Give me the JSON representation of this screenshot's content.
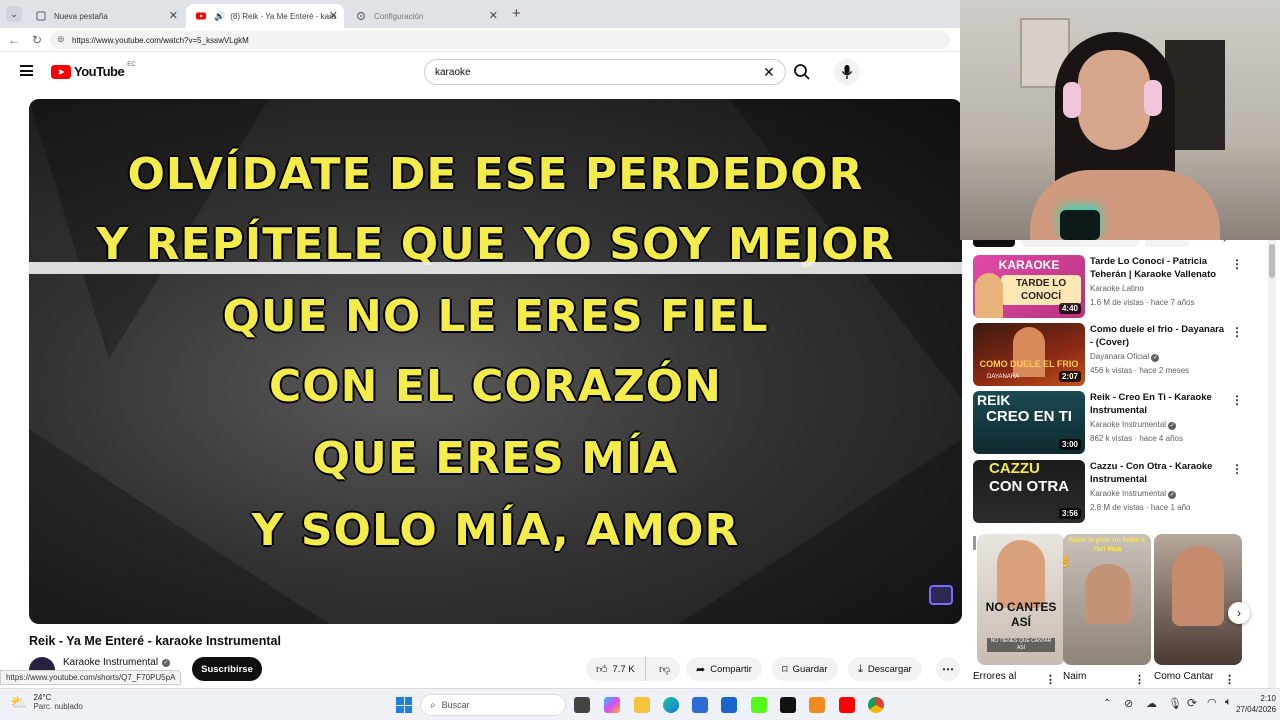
{
  "browser": {
    "tabs": [
      {
        "label": "Nueva pestaña"
      },
      {
        "label": "(8) Reik - Ya Me Enteré - kara"
      },
      {
        "label": "Configuración"
      }
    ],
    "url": "https://www.youtube.com/watch?v=5_ksswVLgkM",
    "status_url": "https://www.youtube.com/shorts/Q7_F70PU5pA"
  },
  "youtube": {
    "logo_text": "YouTube",
    "country": "EC",
    "search_value": "karaoke"
  },
  "video": {
    "lyrics": [
      "OLVÍDATE DE ESE PERDEDOR",
      "Y REPÍTELE QUE YO SOY MEJOR",
      "QUE NO LE ERES FIEL",
      "CON EL CORAZÓN",
      "QUE ERES MÍA",
      "Y SOLO MÍA, AMOR"
    ],
    "title": "Reik - Ya Me Enteré - karaoke Instrumental",
    "channel": "Karaoke Instrumental",
    "subscribe_label": "Suscribirse",
    "likes": "7.7 K",
    "share_label": "Compartir",
    "save_label": "Guardar",
    "download_label": "Descargar"
  },
  "recommendations": [
    {
      "title": "Tarde Lo Conocí - Patricia Teherán | Karaoke Vallenato",
      "channel": "Karaoke Latino",
      "meta": "1.6 M de vistas · hace 7 años",
      "duration": "4:40",
      "thumb_text": "KARAOKE",
      "thumb_text2": "TARDE LO CONOCÍ",
      "verified": false
    },
    {
      "title": "Como duele el frio - Dayanara - (Cover)",
      "channel": "Dayanara Oficial",
      "meta": "456 k vistas · hace 2 meses",
      "duration": "2:07",
      "thumb_text": "COMO DUELE EL FRIO",
      "thumb_text2": "DAYANARA",
      "verified": true
    },
    {
      "title": "Reik - Creo En Ti - Karaoke Instrumental",
      "channel": "Karaoke Instrumental",
      "meta": "862 k vistas · hace 4 años",
      "duration": "3:00",
      "thumb_text": "REIK",
      "thumb_text2": "CREO EN TI",
      "verified": true
    },
    {
      "title": "Cazzu - Con Otra - Karaoke Instrumental",
      "channel": "Karaoke Instrumental",
      "meta": "2.8 M de vistas · hace 1 año",
      "duration": "3:56",
      "thumb_text": "CAZZU",
      "thumb_text2": "CON OTRA",
      "verified": true
    }
  ],
  "shorts": [
    {
      "label": "Errores al",
      "overlay": "NO CANTES ASÍ",
      "overlay2": "NO TIENES QUE CANTAR ASÍ"
    },
    {
      "label": "Naim",
      "overlay": "Naim le pide un bebé a Yeri Mua"
    },
    {
      "label": "Como Cantar",
      "overlay": ""
    }
  ],
  "taskbar": {
    "weather_temp": "24°C",
    "weather_desc": "Parc. nublado",
    "search_placeholder": "Buscar",
    "time": "2:10",
    "date": "27/04/2026"
  },
  "colors": {
    "youtube_red": "#ff0000",
    "lyric_yellow": "#f3ec4a",
    "subscribe_bg": "#0f0f0f"
  }
}
